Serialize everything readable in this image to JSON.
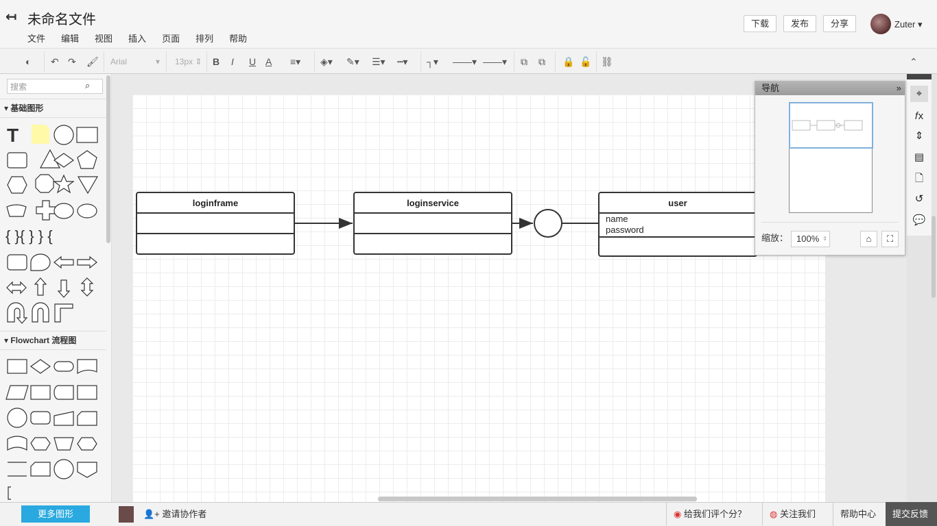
{
  "header": {
    "title": "未命名文件",
    "menu": [
      "文件",
      "编辑",
      "视图",
      "插入",
      "页面",
      "排列",
      "帮助"
    ],
    "download": "下载",
    "publish": "发布",
    "share": "分享",
    "user": "Zuter"
  },
  "toolbar": {
    "font": "Arial",
    "size": "13px",
    "bold": "B",
    "italic": "I",
    "underline": "U",
    "fontcolor": "A"
  },
  "left": {
    "search_placeholder": "搜索",
    "section_basic": "基础图形",
    "section_flow": "Flowchart 流程图",
    "more_shapes": "更多图形"
  },
  "diagram": {
    "boxes": [
      {
        "title": "loginframe",
        "attrs": []
      },
      {
        "title": "loginservice",
        "attrs": []
      },
      {
        "title": "user",
        "attrs": [
          "name",
          "password"
        ]
      }
    ]
  },
  "nav": {
    "title": "导航",
    "zoom_label": "缩放：",
    "zoom_value": "100%"
  },
  "bottom": {
    "invite": "邀请协作者",
    "rate": "给我们评个分？",
    "follow": "关注我们",
    "help": "帮助中心",
    "feedback": "提交反馈"
  }
}
